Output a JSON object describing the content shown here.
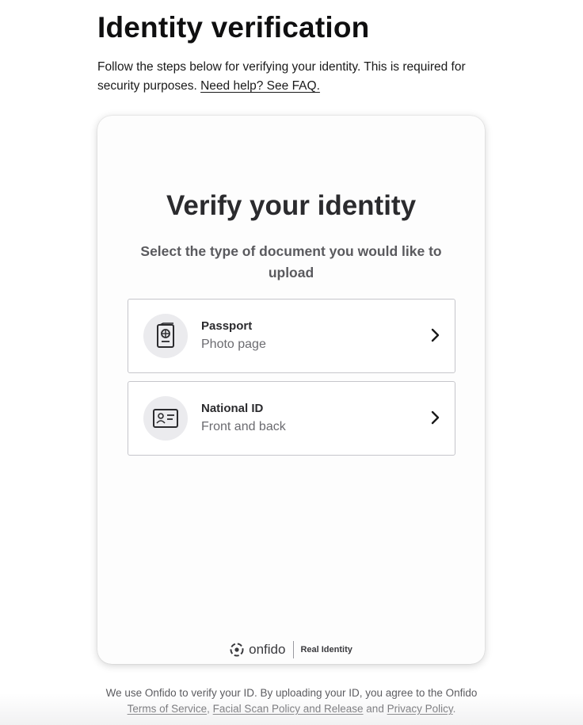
{
  "page": {
    "title": "Identity verification",
    "intro_text": "Follow the steps below for verifying your identity. This is required for security purposes.",
    "help_link": "Need help? See FAQ."
  },
  "card": {
    "title": "Verify your identity",
    "subtitle": "Select the type of document you would like to upload",
    "options": [
      {
        "label": "Passport",
        "hint": "Photo page",
        "icon": "passport-icon"
      },
      {
        "label": "National ID",
        "hint": "Front and back",
        "icon": "id-card-icon"
      }
    ],
    "footer": {
      "brand": "onfido",
      "tagline": "Real Identity"
    }
  },
  "disclaimer": {
    "prefix": "We use Onfido to verify your ID. By uploading your ID, you agree to the Onfido",
    "terms_link": "Terms of Service",
    "separator": ",",
    "facial_link": "Facial Scan Policy and Release",
    "and_text": "and",
    "privacy_link": "Privacy Policy",
    "suffix": "."
  },
  "colors": {
    "text_primary": "#0f0f10",
    "text_muted": "#6b6b70",
    "border": "#c6c6cb",
    "icon_bg": "#ebebee"
  }
}
